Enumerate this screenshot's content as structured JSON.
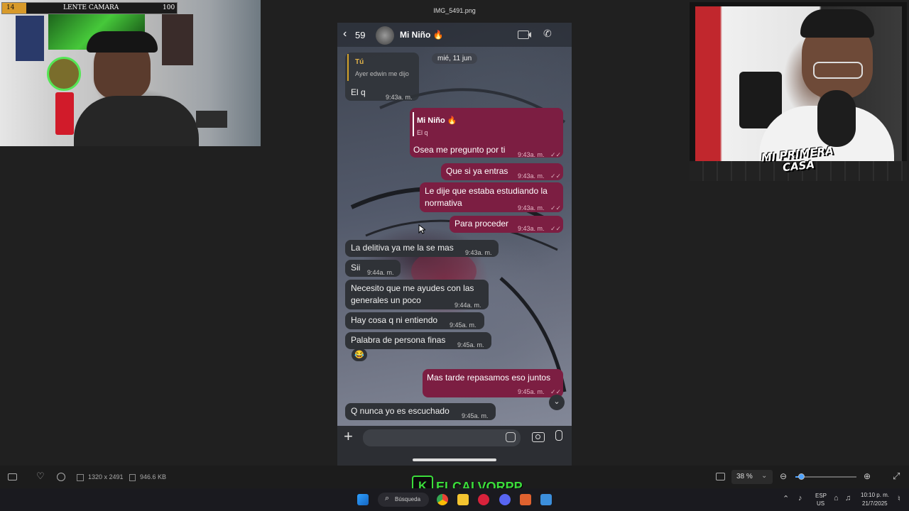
{
  "viewer": {
    "filename": "IMG_5491.png",
    "dimensions": "1320 x 2491",
    "filesize": "946.6 KB",
    "zoom": "38 %"
  },
  "overlay_left": {
    "level": "14",
    "label": "LENTE CAMARA",
    "points": "100"
  },
  "overlay_right": {
    "logo_text": "MI PRIMERA CASA"
  },
  "chat": {
    "back_count": "59",
    "contact_name": "Mi Niño 🔥",
    "date_label": "mié, 11 jun",
    "messages": [
      {
        "dir": "in",
        "reply_author": "Tú",
        "reply_text": "Ayer edwin me dijo",
        "text": "El q",
        "time": "9:43a. m."
      },
      {
        "dir": "out",
        "reply_author": "Mi Niño 🔥",
        "reply_text": "El q",
        "text": "Osea me pregunto por ti",
        "time": "9:43a. m."
      },
      {
        "dir": "out",
        "text": "Que si ya entras",
        "time": "9:43a. m."
      },
      {
        "dir": "out",
        "text": "Le dije que estaba estudiando la normativa",
        "time": "9:43a. m."
      },
      {
        "dir": "out",
        "text": "Para proceder",
        "time": "9:43a. m."
      },
      {
        "dir": "in",
        "text": "La delitiva ya me la se mas",
        "time": "9:43a. m."
      },
      {
        "dir": "in",
        "text": "Sii",
        "time": "9:44a. m."
      },
      {
        "dir": "in",
        "text": "Necesito que me ayudes con las generales un poco",
        "time": "9:44a. m."
      },
      {
        "dir": "in",
        "text": "Hay cosa q ni entiendo",
        "time": "9:45a. m."
      },
      {
        "dir": "in",
        "text": "Palabra de persona finas",
        "time": "9:45a. m.",
        "reaction": "😂"
      },
      {
        "dir": "out",
        "text": "Mas tarde repasamos eso juntos",
        "time": "9:45a. m."
      },
      {
        "dir": "in",
        "text": "Q nunca yo es escuchado",
        "time": "9:45a. m."
      }
    ]
  },
  "taskbar": {
    "search_label": "Búsqueda",
    "lang_top": "ESP",
    "lang_bottom": "US",
    "clock_time": "10:10 p. m.",
    "clock_date": "21/7/2025",
    "streamer_tag": "ELCALVORPP",
    "streamer_badge": "K"
  },
  "colors": {
    "outgoing_bubble": "#7c1e42",
    "incoming_bubble": "#2f3237",
    "streamer_green": "#3bdc3b"
  }
}
